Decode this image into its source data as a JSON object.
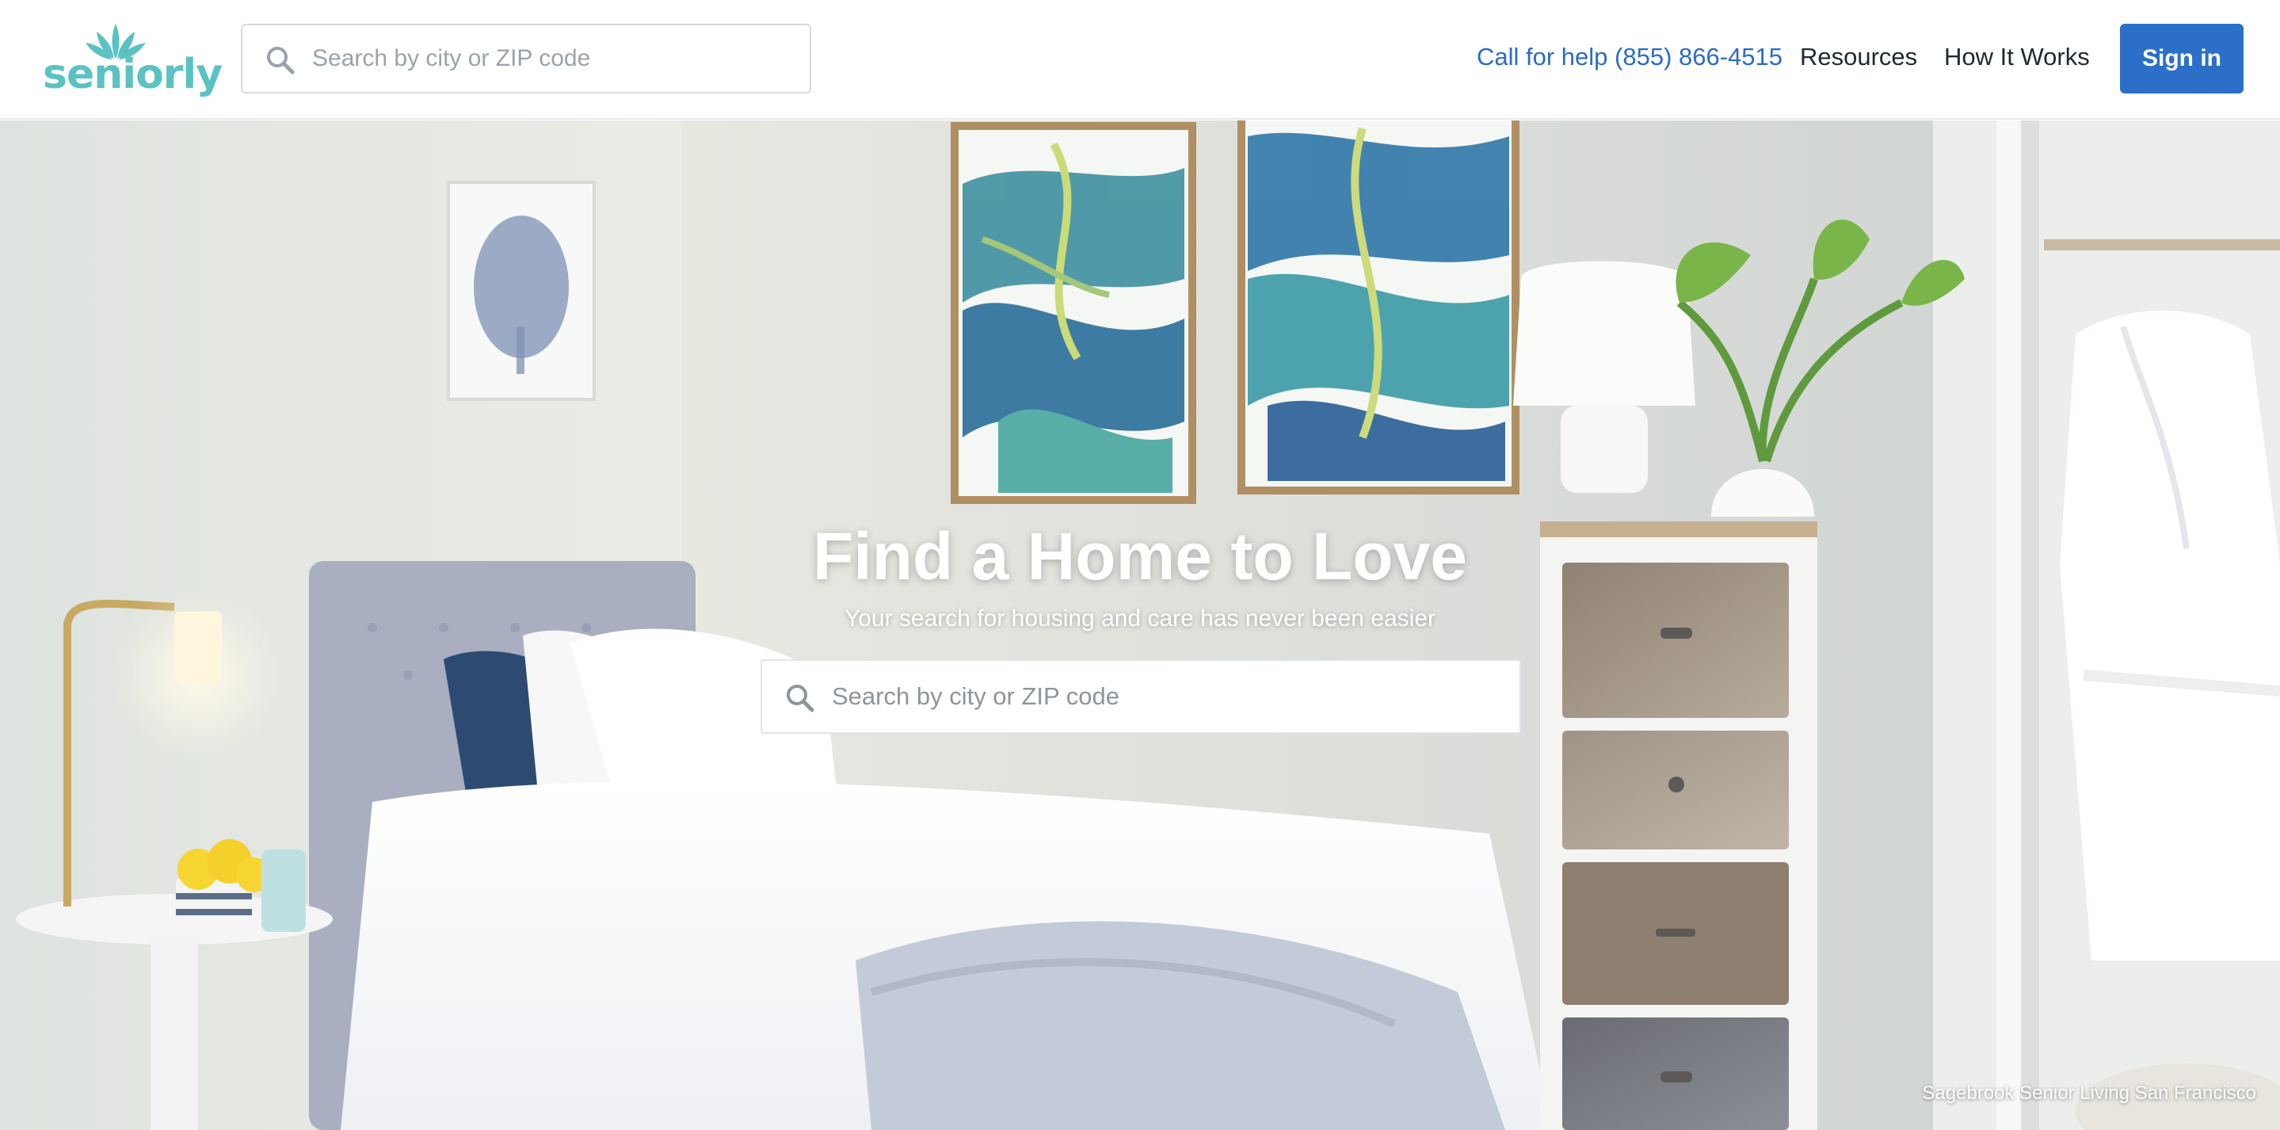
{
  "brand": {
    "name": "seniorly",
    "accent_color": "#5bc2c2",
    "primary_color": "#2b6fc9"
  },
  "header": {
    "search": {
      "placeholder": "Search by city or ZIP code",
      "icon": "search-icon"
    },
    "nav": {
      "help_label": "Call for help (855) 866-4515",
      "resources_label": "Resources",
      "how_it_works_label": "How It Works"
    },
    "signin_label": "Sign in"
  },
  "hero": {
    "title": "Find a Home to Love",
    "subtitle": "Your search for housing and care has never been easier",
    "search": {
      "placeholder": "Search by city or ZIP code",
      "icon": "search-icon"
    },
    "caption": "Sagebrook Senior Living San Francisco"
  }
}
